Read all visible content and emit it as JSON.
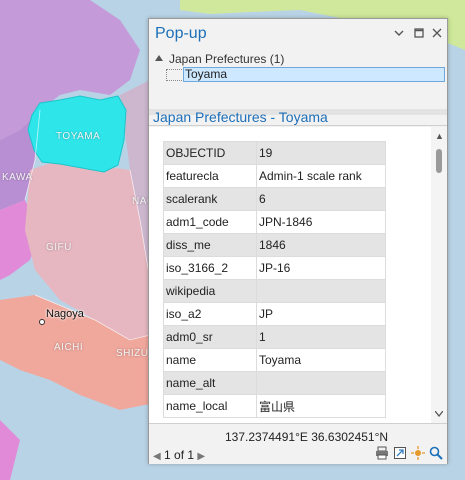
{
  "map": {
    "labels": {
      "toyama": "TOYAMA",
      "kawa": "KAWA",
      "gifu": "GIFU",
      "nagoya": "Nagoya",
      "aichi": "AICHI",
      "shizu": "SHIZU",
      "nag": "NAG"
    },
    "colors": {
      "water": "#b9d3e6",
      "toyama_selected": "#2ee6ea",
      "gifu": "#e6b7c1",
      "nagano": "#cdb7cf",
      "ishikawa": "#c59ad9",
      "fukui": "#e08ad8",
      "aichi": "#f0a79c",
      "shizuoka": "#e4a8e0",
      "niigata": "#cfe89b"
    }
  },
  "popup": {
    "title": "Pop-up",
    "buttons": {
      "options": "⌵",
      "maximize": "□",
      "close": "✕"
    },
    "tree": {
      "root": "Japan Prefectures  (1)",
      "item": "Toyama"
    },
    "feature_title": "Japan Prefectures - Toyama",
    "attributes": [
      {
        "key": "OBJECTID",
        "value": "19"
      },
      {
        "key": "featurecla",
        "value": "Admin-1 scale rank"
      },
      {
        "key": "scalerank",
        "value": "6"
      },
      {
        "key": "adm1_code",
        "value": "JPN-1846"
      },
      {
        "key": "diss_me",
        "value": "1846"
      },
      {
        "key": "iso_3166_2",
        "value": "JP-16"
      },
      {
        "key": "wikipedia",
        "value": ""
      },
      {
        "key": "iso_a2",
        "value": "JP"
      },
      {
        "key": "adm0_sr",
        "value": "1"
      },
      {
        "key": "name",
        "value": "Toyama"
      },
      {
        "key": "name_alt",
        "value": ""
      },
      {
        "key": "name_local",
        "value": "富山県"
      }
    ],
    "coordinates": "137.2374491°E 36.6302451°N",
    "pager": {
      "text": "1 of 1"
    },
    "accent_color": "#1c6fb8"
  }
}
